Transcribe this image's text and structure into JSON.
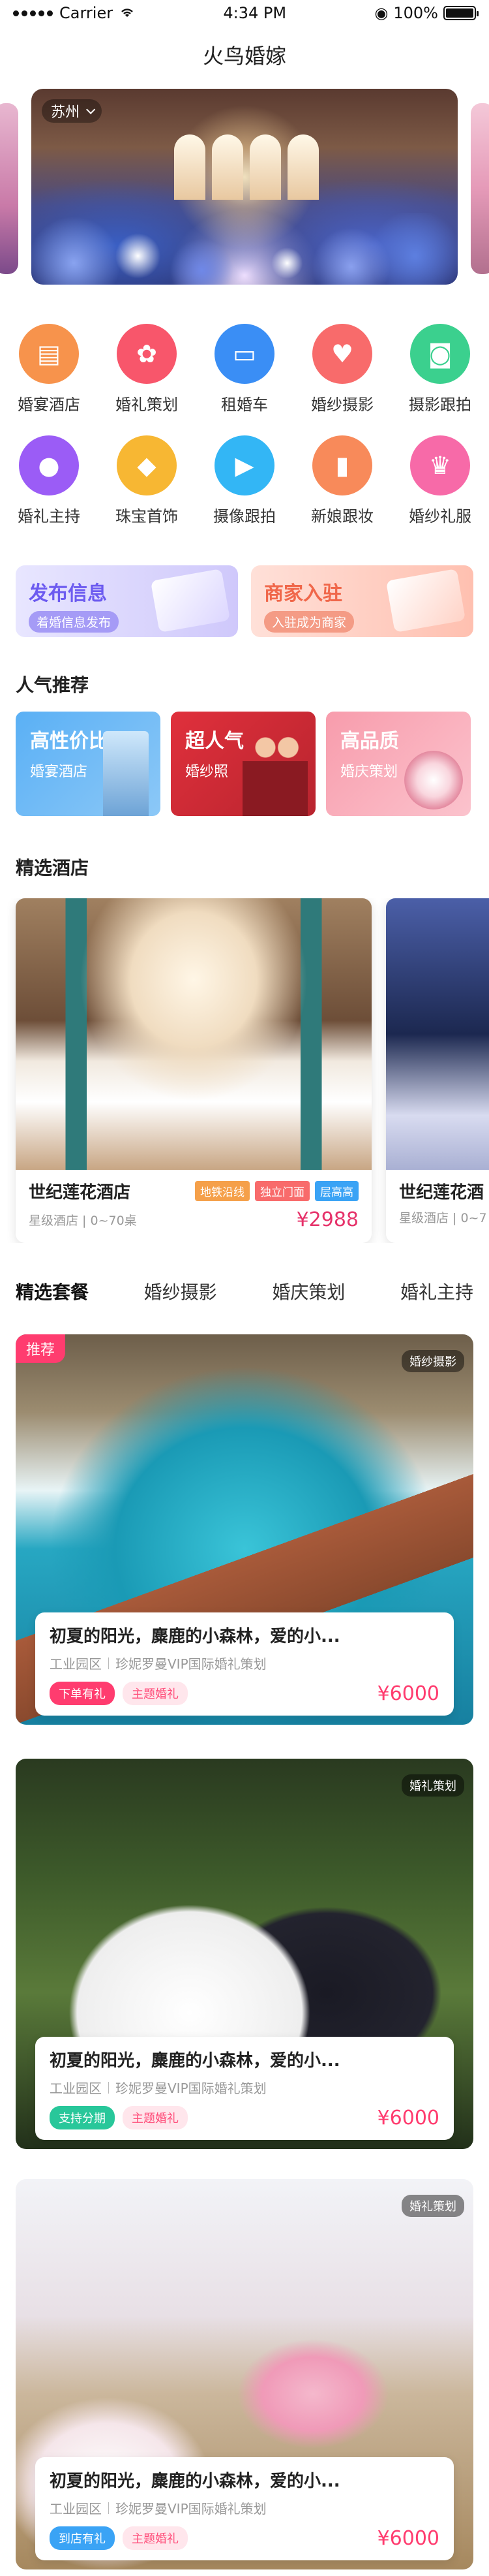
{
  "status": {
    "carrier": "Carrier",
    "time": "4:34 PM",
    "battery": "100%"
  },
  "nav": {
    "title": "火鸟婚嫁"
  },
  "banner": {
    "city": "苏州"
  },
  "categories": [
    {
      "label": "婚宴酒店",
      "icon": "hotel-icon",
      "color": "#f7934c"
    },
    {
      "label": "婚礼策划",
      "icon": "flower-icon",
      "color": "#f8566b"
    },
    {
      "label": "租婚车",
      "icon": "car-icon",
      "color": "#3a8ef5"
    },
    {
      "label": "婚纱摄影",
      "icon": "dress-icon",
      "color": "#f86b6b"
    },
    {
      "label": "摄影跟拍",
      "icon": "camera-icon",
      "color": "#3bd08e"
    },
    {
      "label": "婚礼主持",
      "icon": "microphone-icon",
      "color": "#9b5cf6"
    },
    {
      "label": "珠宝首饰",
      "icon": "diamond-icon",
      "color": "#f7b733"
    },
    {
      "label": "摄像跟拍",
      "icon": "video-icon",
      "color": "#33b6f5"
    },
    {
      "label": "新娘跟妆",
      "icon": "lipstick-icon",
      "color": "#f88a5a"
    },
    {
      "label": "婚纱礼服",
      "icon": "gown-icon",
      "color": "#f76aa8"
    }
  ],
  "promo": [
    {
      "title": "发布信息",
      "sub": "着婚信息发布"
    },
    {
      "title": "商家入驻",
      "sub": "入驻成为商家"
    }
  ],
  "popular": {
    "title": "人气推荐",
    "items": [
      {
        "title": "高性价比",
        "sub": "婚宴酒店"
      },
      {
        "title": "超人气",
        "sub": "婚纱照"
      },
      {
        "title": "高品质",
        "sub": "婚庆策划"
      }
    ]
  },
  "hotels": {
    "title": "精选酒店",
    "items": [
      {
        "name": "世纪莲花酒店",
        "tags": [
          "地铁沿线",
          "独立门面",
          "层高高"
        ],
        "sub": "星级酒店 | 0~70桌",
        "price": "¥2988"
      },
      {
        "name": "世纪莲花酒",
        "sub": "星级酒店 | 0~7"
      }
    ]
  },
  "tabs": [
    "精选套餐",
    "婚纱摄影",
    "婚庆策划",
    "婚礼主持"
  ],
  "packages": [
    {
      "badge": "推荐",
      "category": "婚纱摄影",
      "title": "初夏的阳光，麋鹿的小森林，爱的小...",
      "place": "工业园区",
      "vendor": "珍妮罗曼VIP国际婚礼策划",
      "chip1": "下单有礼",
      "chip2": "主题婚礼",
      "price": "¥6000"
    },
    {
      "category": "婚礼策划",
      "title": "初夏的阳光，麋鹿的小森林，爱的小...",
      "place": "工业园区",
      "vendor": "珍妮罗曼VIP国际婚礼策划",
      "chip1": "支持分期",
      "chip2": "主题婚礼",
      "price": "¥6000"
    },
    {
      "category": "婚礼策划",
      "title": "初夏的阳光，麋鹿的小森林，爱的小...",
      "place": "工业园区",
      "vendor": "珍妮罗曼VIP国际婚礼策划",
      "chip1": "到店有礼",
      "chip2": "主题婚礼",
      "price": "¥6000"
    }
  ]
}
